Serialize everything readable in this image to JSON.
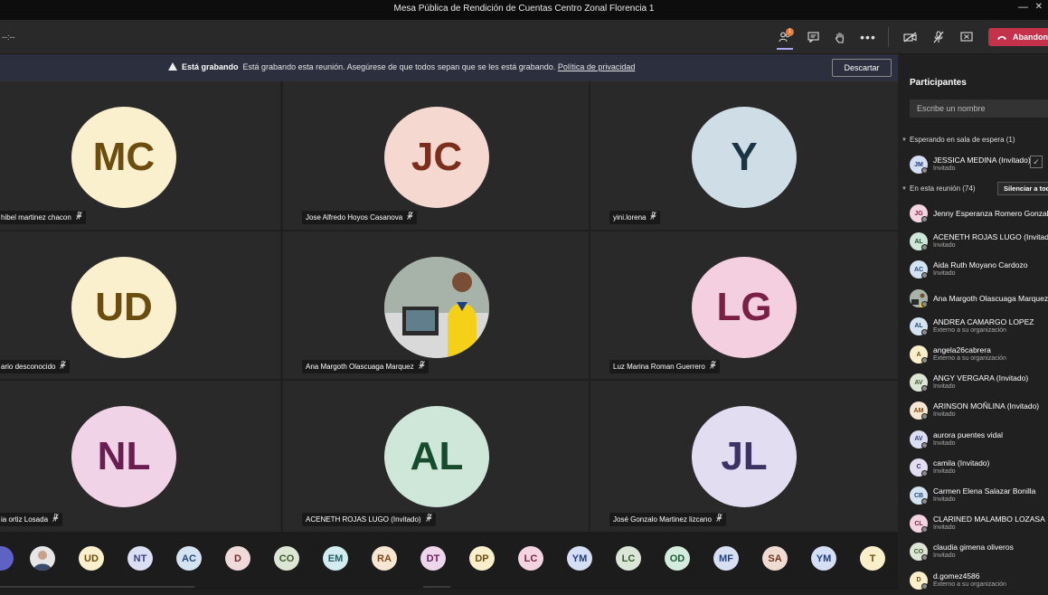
{
  "window": {
    "title": "Mesa Pública de Rendición de Cuentas Centro Zonal Florencia 1",
    "minimize": "—",
    "close": "✕"
  },
  "toolbar": {
    "timer": "--:--",
    "participants_badge": "1",
    "leave_label": "Abandonar",
    "colors": {
      "leave": "#c4314b",
      "accent": "#a8a8f0"
    }
  },
  "recording_banner": {
    "title": "Está grabando",
    "message": "Está grabando esta reunión. Asegúrese de que todos sepan que se les está grabando.",
    "link": "Política de privacidad",
    "dismiss": "Descartar"
  },
  "tiles": [
    {
      "initials": "MC",
      "name": "hibel martinez chacon",
      "bg": "#fbf0cd",
      "fg": "#6b4d10"
    },
    {
      "initials": "JC",
      "name": "Jose Alfredo Hoyos Casanova",
      "bg": "#f5d8d0",
      "fg": "#7a2e1b"
    },
    {
      "initials": "Y",
      "name": "yini.lorena",
      "bg": "#cfdde6",
      "fg": "#1b3443"
    },
    {
      "initials": "UD",
      "name": "ario desconocido",
      "bg": "#fbf0cd",
      "fg": "#6b4d10"
    },
    {
      "initials": "",
      "name": "Ana Margoth Olascuaga Marquez",
      "bg": "#a7b3a8",
      "fg": "#222"
    },
    {
      "initials": "LG",
      "name": "Luz Marina Roman Guerrero",
      "bg": "#f4cfdf",
      "fg": "#7a1f45"
    },
    {
      "initials": "NL",
      "name": "ia ortiz Losada",
      "bg": "#f1d3e7",
      "fg": "#6a1d50"
    },
    {
      "initials": "AL",
      "name": "ACENETH ROJAS LUGO (Invitado)",
      "bg": "#cfe7d9",
      "fg": "#174b2d"
    },
    {
      "initials": "JL",
      "name": "José Gonzalo Martinez lizcano",
      "bg": "#e2ddf1",
      "fg": "#3d3264"
    }
  ],
  "strip": [
    {
      "initials": "",
      "bg": "#5d62c4",
      "fg": "#fff"
    },
    {
      "initials": "",
      "bg": "#e6e6e6",
      "fg": "#333"
    },
    {
      "initials": "UD",
      "bg": "#fbf0cd",
      "fg": "#6b4d10"
    },
    {
      "initials": "NT",
      "bg": "#dcdff4",
      "fg": "#3b3f7a"
    },
    {
      "initials": "AC",
      "bg": "#d4e3f1",
      "fg": "#244a73"
    },
    {
      "initials": "D",
      "bg": "#f0d9d9",
      "fg": "#6e2b2b"
    },
    {
      "initials": "CO",
      "bg": "#dde6d5",
      "fg": "#3d5a2c"
    },
    {
      "initials": "EM",
      "bg": "#d2ecef",
      "fg": "#215c65"
    },
    {
      "initials": "RA",
      "bg": "#f6e6d2",
      "fg": "#7a4a1b"
    },
    {
      "initials": "DT",
      "bg": "#eed7ea",
      "fg": "#6a1d60"
    },
    {
      "initials": "DP",
      "bg": "#faefcb",
      "fg": "#6b4d10"
    },
    {
      "initials": "LC",
      "bg": "#f5d4e2",
      "fg": "#7a1f45"
    },
    {
      "initials": "YM",
      "bg": "#d4def4",
      "fg": "#1f3b7a"
    },
    {
      "initials": "LC",
      "bg": "#dce6d8",
      "fg": "#365c2a"
    },
    {
      "initials": "OD",
      "bg": "#d3ecdd",
      "fg": "#1e5a35"
    },
    {
      "initials": "MF",
      "bg": "#d6e0f2",
      "fg": "#27427a"
    },
    {
      "initials": "SA",
      "bg": "#f0dbd3",
      "fg": "#6e351f"
    },
    {
      "initials": "YM",
      "bg": "#d4def4",
      "fg": "#1f3b7a"
    },
    {
      "initials": "T",
      "bg": "#faefcb",
      "fg": "#6b4d10"
    }
  ],
  "panel": {
    "title": "Participantes",
    "search_placeholder": "Escribe un nombre",
    "lobby_label": "Esperando en sala de espera (1)",
    "lobby": [
      {
        "initials": "JM",
        "name": "JESSICA MEDINA (Invitado)",
        "sub": "Invitado",
        "bg": "#d4def4",
        "fg": "#1f3b7a"
      }
    ],
    "in_meeting_label": "En esta reunión (74)",
    "mute_all": "Silenciar a todos",
    "participants": [
      {
        "initials": "JG",
        "name": "Jenny Esperanza Romero Gonzalez",
        "sub": "",
        "bg": "#f5d4e2",
        "fg": "#7a1f45"
      },
      {
        "initials": "AL",
        "name": "ACENETH ROJAS LUGO (Invitado)",
        "sub": "Invitado",
        "bg": "#cfe7d9",
        "fg": "#174b2d"
      },
      {
        "initials": "AC",
        "name": "Aida Ruth Moyano Cardozo",
        "sub": "Invitado",
        "bg": "#d4e3f1",
        "fg": "#244a73"
      },
      {
        "initials": "",
        "name": "Ana Margoth Olascuaga Marquez",
        "sub": "",
        "bg": "#a7b3a8",
        "fg": "#222"
      },
      {
        "initials": "AL",
        "name": "ANDREA CAMARGO LOPEZ",
        "sub": "Externo a su organización",
        "bg": "#d4e3f1",
        "fg": "#244a73"
      },
      {
        "initials": "A",
        "name": "angela26cabrera",
        "sub": "Externo a su organización",
        "bg": "#faefcb",
        "fg": "#6b4d10"
      },
      {
        "initials": "AV",
        "name": "ANGY VERGARA (Invitado)",
        "sub": "Invitado",
        "bg": "#dde6d5",
        "fg": "#3d5a2c"
      },
      {
        "initials": "AM",
        "name": "ARINSON MOÑLINA (Invitado)",
        "sub": "Invitado",
        "bg": "#f6e6d2",
        "fg": "#7a4a1b"
      },
      {
        "initials": "AV",
        "name": "aurora puentes vidal",
        "sub": "Invitado",
        "bg": "#dcdff4",
        "fg": "#3b3f7a"
      },
      {
        "initials": "C",
        "name": "camila (Invitado)",
        "sub": "Invitado",
        "bg": "#e2ddf1",
        "fg": "#3d3264"
      },
      {
        "initials": "CB",
        "name": "Carmen Elena Salazar Bonilla",
        "sub": "Invitado",
        "bg": "#d4e3f1",
        "fg": "#244a73"
      },
      {
        "initials": "CL",
        "name": "CLARINED MALAMBO LOZASA",
        "sub": "Invitado",
        "bg": "#f5d4e2",
        "fg": "#7a1f45"
      },
      {
        "initials": "CO",
        "name": "claudia gimena oliveros",
        "sub": "Invitado",
        "bg": "#dde6d5",
        "fg": "#3d5a2c"
      },
      {
        "initials": "D",
        "name": "d.gomez4586",
        "sub": "Externo a su organización",
        "bg": "#faefcb",
        "fg": "#6b4d10"
      }
    ]
  }
}
